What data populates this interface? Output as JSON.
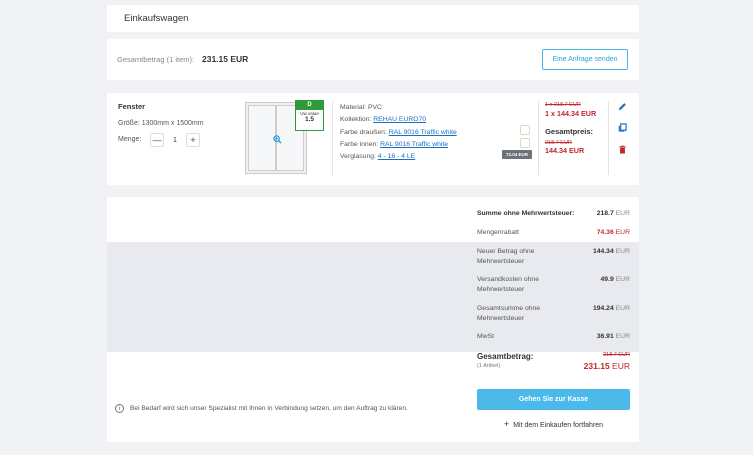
{
  "header": {
    "title": "Einkaufswagen"
  },
  "total_bar": {
    "label": "Gesamtbetrag (1 item):",
    "value": "231.15 EUR",
    "request_button": "Eine Anfrage senden"
  },
  "item": {
    "name": "Fenster",
    "size": "Größe: 1300mm x 1500mm",
    "quantity_label": "Menge:",
    "quantity": "1",
    "minus": "—",
    "plus": "+",
    "energy_grade": "D",
    "uw_label": "Uw value",
    "uw_value": "1.5",
    "specs": {
      "material": "Material: PVC",
      "collection_label": "Kollektion:",
      "collection_value": "REHAU EURO70",
      "color_out_label": "Farbe draußen:",
      "color_out_value": "RAL 9016 Traffic white",
      "color_in_label": "Farbe innen:",
      "color_in_value": "RAL 9016 Traffic white",
      "glazing_label": "Verglasung:",
      "glazing_value": "4 - 16 - 4 LE"
    },
    "price_tag": "72.04 EUR",
    "unit_price_old": "1 x 218.7 EUR",
    "unit_price_new": "1 x 144.34 EUR",
    "total_label": "Gesamtpreis:",
    "total_old": "218.7 EUR",
    "total_new": "144.34 EUR"
  },
  "summary": {
    "rows": [
      {
        "label": "Summe ohne Mehrwertsteuer:",
        "value": "218.7",
        "unit": "EUR"
      },
      {
        "label": "Mengenrabatt",
        "value": "74.36",
        "unit": "EUR"
      },
      {
        "label": "Neuer Betrag ohne Mehrwertsteuer",
        "value": "144.34",
        "unit": "EUR"
      },
      {
        "label": "Versandkosten ohne Mehrwertsteuer",
        "value": "49.9",
        "unit": "EUR"
      },
      {
        "label": "Gesamtsumme ohne Mehrwertsteuer",
        "value": "194.24",
        "unit": "EUR"
      },
      {
        "label": "MwSt",
        "value": "36.91",
        "unit": "EUR"
      }
    ],
    "grand_total_label": "Gesamtbetrag:",
    "grand_total_sub": "(1 Artikel)",
    "grand_total_old": "218.7 EUR",
    "grand_total_value": "231.15",
    "grand_total_unit": "EUR",
    "info_text": "Bei Bedarf wird sich unser Spezialist mit Ihnen in Verbindung setzen, um den Auftrag zu klären.",
    "checkout_button": "Gehen Sie zur Kasse",
    "continue_link": "Mit dem Einkaufen fortfahren"
  },
  "colors": {
    "accent": "#4bb9ea",
    "price_red": "#c1272d",
    "energy_green": "#2e9a3a"
  },
  "icons": [
    "zoom-in-icon",
    "edit-icon",
    "copy-icon",
    "trash-icon",
    "info-icon",
    "plus-icon"
  ]
}
